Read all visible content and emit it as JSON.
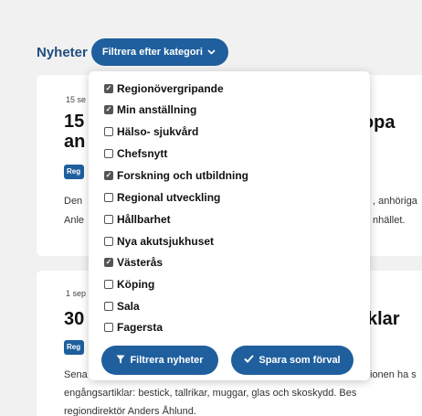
{
  "header": {
    "title": "Nyheter",
    "filter_button": "Filtrera efter kategori"
  },
  "cards": [
    {
      "date": "15 se",
      "title_left_1": "15",
      "title_left_2": "an",
      "title_right": ": slopa",
      "badge": "Reg",
      "text_left_1": "Den",
      "text_left_2": "Anle",
      "text_right_1": ", anhöriga",
      "text_right_2": "nhället."
    },
    {
      "date": "1 sep",
      "title_left": "30",
      "title_right": "rtiklar",
      "badge": "Reg",
      "text_left_1": "Sena",
      "text_right_1": "ionen ha s",
      "text_line_2": "engångsartiklar: bestick, tallrikar, muggar, glas och skoskydd. Bes",
      "text_line_3": "regiondirektör Anders Åhlund."
    }
  ],
  "dropdown": {
    "options": [
      {
        "label": "Regionövergripande",
        "checked": true
      },
      {
        "label": "Min anställning",
        "checked": true
      },
      {
        "label": "Hälso- sjukvård",
        "checked": false
      },
      {
        "label": "Chefsnytt",
        "checked": false
      },
      {
        "label": "Forskning och utbildning",
        "checked": true
      },
      {
        "label": "Regional utveckling",
        "checked": false
      },
      {
        "label": "Hållbarhet",
        "checked": false
      },
      {
        "label": "Nya akutsjukhuset",
        "checked": false
      },
      {
        "label": "Västerås",
        "checked": true
      },
      {
        "label": "Köping",
        "checked": false
      },
      {
        "label": "Sala",
        "checked": false
      },
      {
        "label": "Fagersta",
        "checked": false
      }
    ],
    "filter_button": "Filtrera nyheter",
    "save_button": "Spara som förval"
  },
  "colors": {
    "accent": "#1f5f9e",
    "heading": "#1f4d80",
    "background": "#f1f1f1"
  },
  "icons": {
    "filter": "funnel-icon",
    "save": "checkmark-icon",
    "dropdown": "chevron-down-icon"
  }
}
